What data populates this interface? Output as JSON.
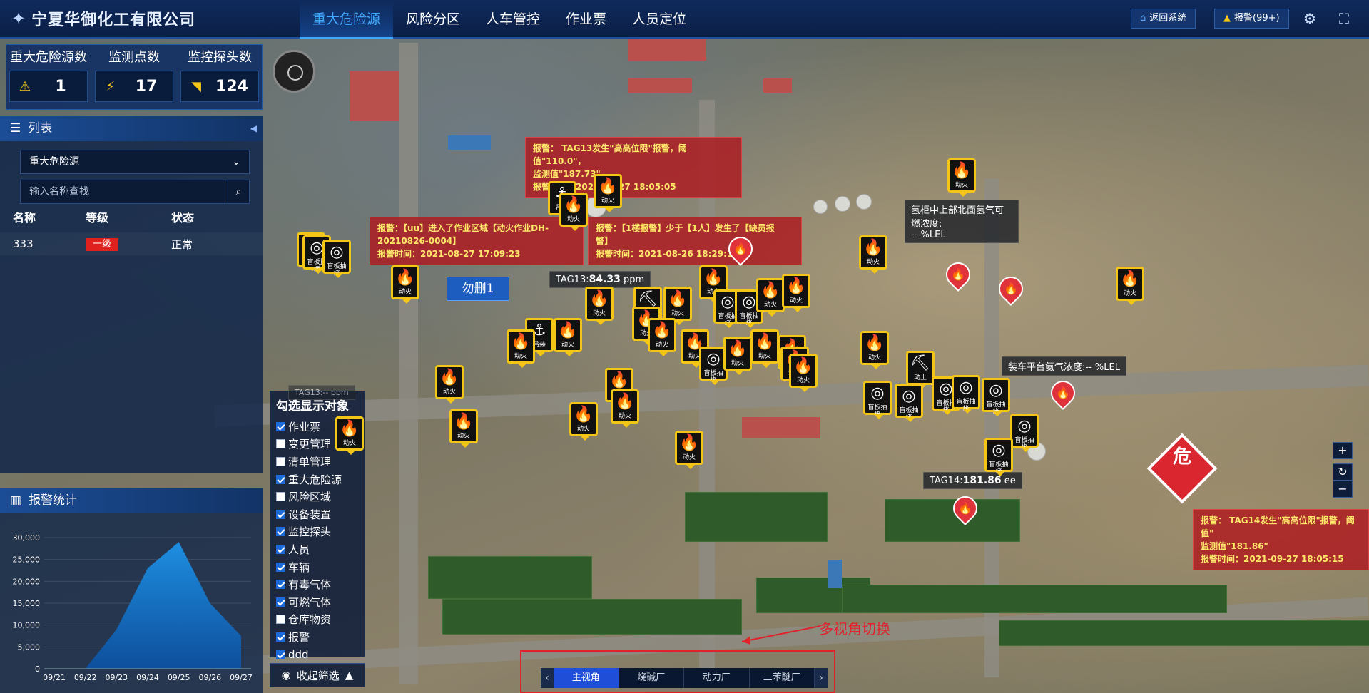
{
  "header": {
    "company": "宁夏华御化工有限公司",
    "nav": [
      "重大危险源",
      "风险分区",
      "人车管控",
      "作业票",
      "人员定位"
    ],
    "active_nav": "重大危险源",
    "return_button": "返回系统",
    "alarm_button": "报警(99+)"
  },
  "stats": [
    {
      "label": "重大危险源数",
      "value": "1",
      "icon": "warning-icon"
    },
    {
      "label": "监测点数",
      "value": "17",
      "icon": "plug-icon"
    },
    {
      "label": "监控探头数",
      "value": "124",
      "icon": "camera-icon"
    }
  ],
  "list_panel": {
    "title": "列表",
    "select_value": "重大危险源",
    "search_placeholder": "输入名称查找",
    "columns": [
      "名称",
      "等级",
      "状态"
    ],
    "rows": [
      {
        "name": "333",
        "level": "一级",
        "status": "正常"
      }
    ]
  },
  "alarm_panel": {
    "title": "报警统计"
  },
  "chart_data": {
    "type": "area",
    "title": "报警统计",
    "categories": [
      "09/21",
      "09/22",
      "09/23",
      "09/24",
      "09/25",
      "09/26",
      "09/27"
    ],
    "values": [
      0,
      0,
      9000,
      23000,
      29000,
      15000,
      7500
    ],
    "yticks": [
      "0",
      "5,000",
      "10,000",
      "15,000",
      "20,000",
      "25,000",
      "30,000"
    ],
    "ylim": [
      0,
      30000
    ],
    "grid": true,
    "color": "#1e8ee0"
  },
  "filter": {
    "title": "勾选显示对象",
    "items": [
      {
        "label": "作业票",
        "checked": true
      },
      {
        "label": "变更管理",
        "checked": false
      },
      {
        "label": "清单管理",
        "checked": false
      },
      {
        "label": "重大危险源",
        "checked": true
      },
      {
        "label": "风险区域",
        "checked": false
      },
      {
        "label": "设备装置",
        "checked": true
      },
      {
        "label": "监控探头",
        "checked": true
      },
      {
        "label": "人员",
        "checked": true
      },
      {
        "label": "车辆",
        "checked": true
      },
      {
        "label": "有毒气体",
        "checked": true
      },
      {
        "label": "可燃气体",
        "checked": true
      },
      {
        "label": "仓库物资",
        "checked": false
      },
      {
        "label": "报警",
        "checked": true
      },
      {
        "label": "ddd",
        "checked": true
      }
    ],
    "collapse_label": "收起筛选"
  },
  "alarms": {
    "a1_line1": "报警：  TAG13发生\"高高位限\"报警，阈值\"110.0\"，",
    "a1_line2": "监测值\"187.73\"",
    "a1_time": "报警时间：2021-09-27 18:05:05",
    "a2_line1": "报警：【uu】进入了作业区域【动火作业DH-",
    "a2_line2": "20210826-0004】",
    "a2_time": "报警时间：2021-08-27 17:09:23",
    "a3_line1": "报警：【1楼报警】少于【1人】发生了【缺员报",
    "a3_line2": "警】",
    "a3_time": "报警时间：2021-08-26 18:29:17",
    "a4_line1": "报警：  TAG14发生\"高高位限\"报警，阈值\"",
    "a4_line2": "监测值\"181.86\"",
    "a4_time": "报警时间：2021-09-27 18:05:15"
  },
  "labels": {
    "tag13_name": "TAG13:",
    "tag13_val": "84.33",
    "tag13_unit": "ppm",
    "tag14_name": "TAG14:",
    "tag14_val": "181.86",
    "tag14_unit": "ee",
    "gas1": "氢柜中上部北面氢气可燃浓度:",
    "gas1_val": "-- %LEL",
    "gas2": "装车平台氨气浓度:-- %LEL",
    "area_name": "勿删1",
    "danger": "危",
    "tag_faded": "TAG13:-- ppm"
  },
  "markers": {
    "fire": "动火",
    "hoist": "吊装",
    "earth": "动土",
    "pipe": "盲板抽堵"
  },
  "views": {
    "tabs": [
      "主视角",
      "烧碱厂",
      "动力厂",
      "二苯醚厂"
    ],
    "active": "主视角",
    "annotation": "多视角切换"
  }
}
